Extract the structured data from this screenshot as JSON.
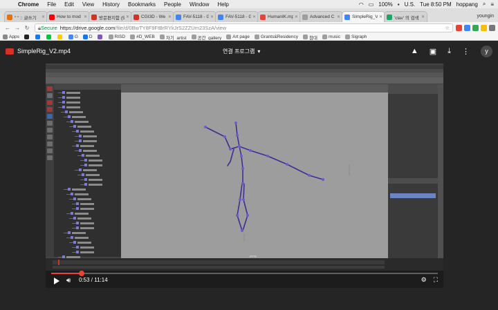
{
  "menubar": {
    "apple": "",
    "items": [
      "Chrome",
      "File",
      "Edit",
      "View",
      "History",
      "Bookmarks",
      "People",
      "Window",
      "Help"
    ],
    "battery": "100%",
    "lang": "U.S.",
    "clock": "Tue 8:50 PM",
    "user": "hoppang"
  },
  "tabs": [
    {
      "label": "\" \" :: 글쓰기",
      "color": "#e8710a",
      "active": false
    },
    {
      "label": "How to mod",
      "color": "#ff0000",
      "active": false
    },
    {
      "label": "방문편지함 (5",
      "color": "#d93025",
      "active": false
    },
    {
      "label": "CGI3D - We",
      "color": "#d93025",
      "active": false
    },
    {
      "label": "FAV-5118 - G",
      "color": "#4285f4",
      "active": false
    },
    {
      "label": "FAV-5118 - G",
      "color": "#4285f4",
      "active": false
    },
    {
      "label": "HumanIK.mp",
      "color": "#ea4335",
      "active": false
    },
    {
      "label": "Advanced C",
      "color": "#9e9e9e",
      "active": false
    },
    {
      "label": "SimpleRig_V",
      "color": "#4285f4",
      "active": true
    },
    {
      "label": "'clav' 의 검색",
      "color": "#1da462",
      "active": false
    }
  ],
  "profile": "youngin",
  "omnibar": {
    "secure": "Secure",
    "host": "https://drive.google.com",
    "path": "/file/d/0BwTY8F9FtBrRYkJrS2ZZUm23SzA/view"
  },
  "bookmarks": [
    {
      "label": "Apps",
      "color": "#888888"
    },
    {
      "label": "",
      "color": "#222222"
    },
    {
      "label": "",
      "color": "#1877f2"
    },
    {
      "label": "",
      "color": "#00c73c"
    },
    {
      "label": "",
      "color": "#ffcc00"
    },
    {
      "label": "G",
      "color": "#4285f4"
    },
    {
      "label": "D",
      "color": "#1a73e8"
    },
    {
      "label": "",
      "color": "#7e57c2"
    },
    {
      "label": "RISD",
      "color": "#9e9e9e"
    },
    {
      "label": "#D_WEB",
      "color": "#9e9e9e"
    },
    {
      "label": "자기_artist",
      "color": "#9e9e9e"
    },
    {
      "label": "공간_gallery",
      "color": "#9e9e9e"
    },
    {
      "label": "Art page",
      "color": "#9e9e9e"
    },
    {
      "label": "Grants&Residency",
      "color": "#9e9e9e"
    },
    {
      "label": "참대",
      "color": "#9e9e9e"
    },
    {
      "label": "music",
      "color": "#9e9e9e"
    },
    {
      "label": "Sigraph",
      "color": "#9e9e9e"
    }
  ],
  "viewer": {
    "title": "SimpleRig_V2.mp4",
    "open_with": "연결 프로그램"
  },
  "video": {
    "current": "0:53",
    "duration": "11:14",
    "time_display": "0:53 / 11:14",
    "progress": 0.079,
    "viewport_label": "persp"
  },
  "colors": {
    "accent_red": "#ea4335",
    "viewer_bg": "#252525",
    "joint": "#3b2f8f"
  }
}
